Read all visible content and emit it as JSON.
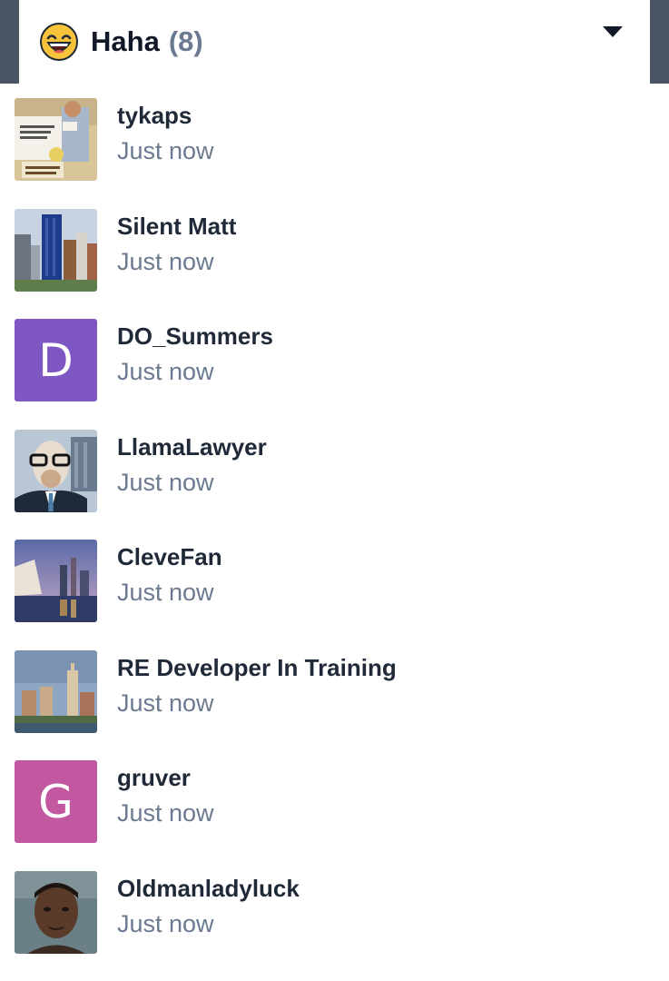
{
  "header": {
    "title": "Haha",
    "count": "(8)",
    "emoji_icon": "laughing-emoji-icon",
    "toggle_icon": "caret-down-icon"
  },
  "users": [
    {
      "name": "tykaps",
      "time": "Just now",
      "avatar": "meme-photo"
    },
    {
      "name": "Silent Matt",
      "time": "Just now",
      "avatar": "city-skyline-photo"
    },
    {
      "name": "DO_Summers",
      "time": "Just now",
      "avatar_letter": "D",
      "avatar_color": "#7e57c2"
    },
    {
      "name": "LlamaLawyer",
      "time": "Just now",
      "avatar": "llama-in-suit-photo"
    },
    {
      "name": "CleveFan",
      "time": "Just now",
      "avatar": "city-at-dusk-photo"
    },
    {
      "name": "RE Developer In Training",
      "time": "Just now",
      "avatar": "city-riverfront-photo"
    },
    {
      "name": "gruver",
      "time": "Just now",
      "avatar_letter": "G",
      "avatar_color": "#c2589f"
    },
    {
      "name": "Oldmanladyluck",
      "time": "Just now",
      "avatar": "portrait-photo"
    }
  ]
}
